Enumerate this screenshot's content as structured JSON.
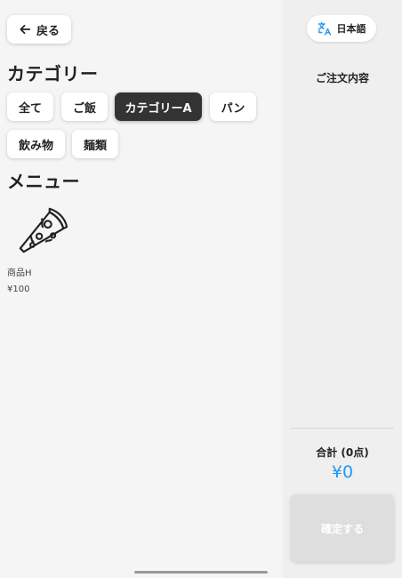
{
  "header": {
    "back_label": "戻る"
  },
  "categories": {
    "title": "カテゴリー",
    "items": [
      {
        "label": "全て",
        "active": false
      },
      {
        "label": "ご飯",
        "active": false
      },
      {
        "label": "カテゴリーA",
        "active": true
      },
      {
        "label": "パン",
        "active": false
      },
      {
        "label": "飲み物",
        "active": false
      },
      {
        "label": "麺類",
        "active": false
      }
    ]
  },
  "menu": {
    "title": "メニュー",
    "items": [
      {
        "name": "商品H",
        "price": "¥100",
        "icon": "pizza-icon"
      }
    ]
  },
  "sidebar": {
    "language_label": "日本語",
    "language_icon": "translate-icon",
    "order_title": "ご注文内容",
    "total_label": "合計 (0点)",
    "total_amount": "¥0",
    "confirm_label": "確定する"
  },
  "colors": {
    "accent": "#2196f3",
    "active_chip": "#333333",
    "disabled_button": "#dedede"
  }
}
